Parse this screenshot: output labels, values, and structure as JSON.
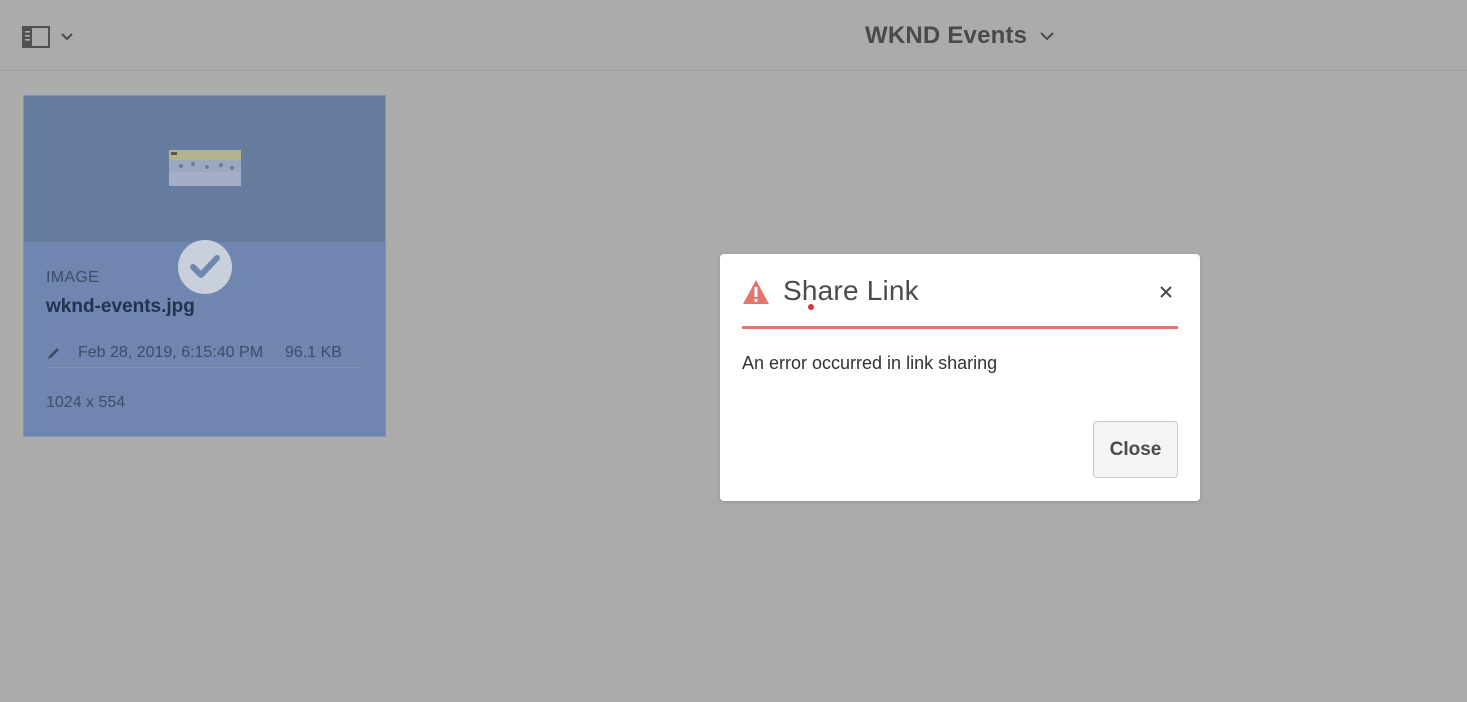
{
  "header": {
    "title": "WKND Events",
    "rail_toggle_icon": "sidebar-layout-icon",
    "dropdown_icon": "chevron-down-icon"
  },
  "card": {
    "type": "IMAGE",
    "name": "wknd-events.jpg",
    "modified": "Feb 28, 2019, 6:15:40 PM",
    "size": "96.1 KB",
    "dimensions": "1024 x 554",
    "selected": true,
    "edit_icon": "pencil-icon",
    "check_icon": "checkmark-icon",
    "selection_color": "#6f86b0"
  },
  "dialog": {
    "title": "Share Link",
    "message": "An error occurred in link sharing",
    "close_label": "Close",
    "alert_icon": "warning-triangle-icon",
    "dismiss_icon": "close-icon",
    "accent_color": "#e4736e"
  },
  "overlay_color": "#ababab"
}
